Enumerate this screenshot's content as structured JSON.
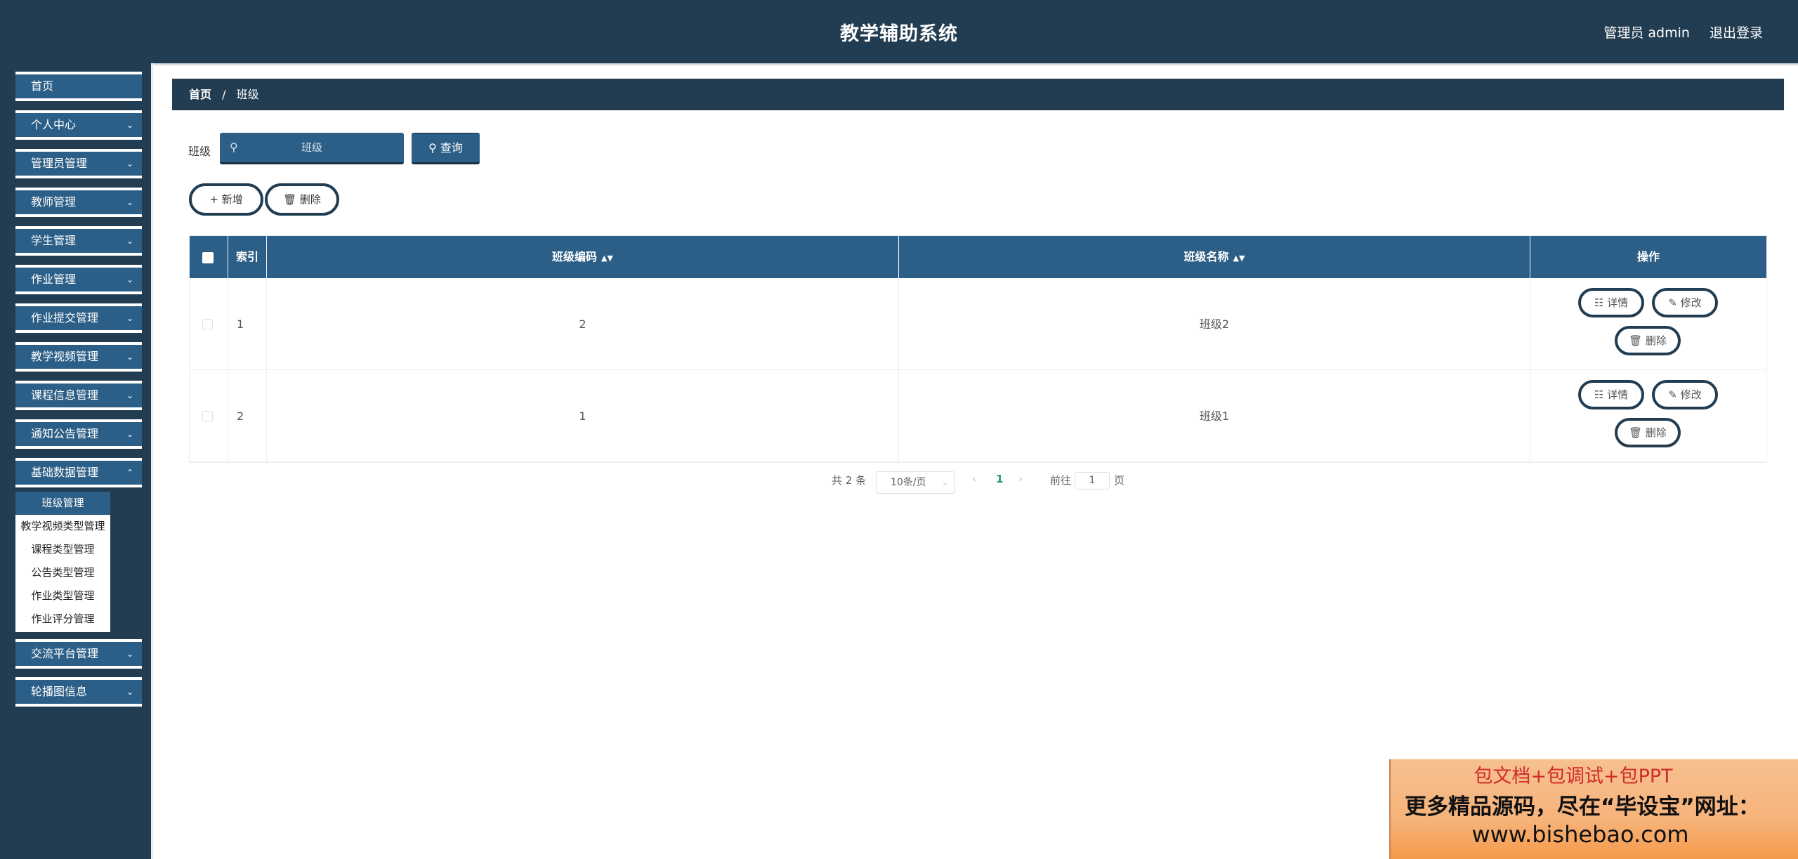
{
  "header": {
    "title": "教学辅助系统",
    "role_user": "管理员 admin",
    "logout_label": "退出登录"
  },
  "sidebar": {
    "items": [
      {
        "label": "首页",
        "expandable": false
      },
      {
        "label": "个人中心",
        "expandable": true
      },
      {
        "label": "管理员管理",
        "expandable": true
      },
      {
        "label": "教师管理",
        "expandable": true
      },
      {
        "label": "学生管理",
        "expandable": true
      },
      {
        "label": "作业管理",
        "expandable": true
      },
      {
        "label": "作业提交管理",
        "expandable": true
      },
      {
        "label": "教学视频管理",
        "expandable": true
      },
      {
        "label": "课程信息管理",
        "expandable": true
      },
      {
        "label": "通知公告管理",
        "expandable": true
      },
      {
        "label": "基础数据管理",
        "expandable": true
      }
    ],
    "submenu": [
      {
        "label": "班级管理",
        "active": true
      },
      {
        "label": "教学视频类型管理",
        "active": false
      },
      {
        "label": "课程类型管理",
        "active": false
      },
      {
        "label": "公告类型管理",
        "active": false
      },
      {
        "label": "作业类型管理",
        "active": false
      },
      {
        "label": "作业评分管理",
        "active": false
      }
    ],
    "items_after": [
      {
        "label": "交流平台管理",
        "expandable": true
      },
      {
        "label": "轮播图信息",
        "expandable": true
      }
    ]
  },
  "breadcrumb": {
    "home": "首页",
    "separator": "/",
    "current": "班级"
  },
  "search": {
    "label": "班级",
    "placeholder": "班级",
    "query_label": "查询"
  },
  "actions": {
    "add_label": "新增",
    "delete_label": "删除"
  },
  "table": {
    "columns": [
      "索引",
      "班级编码",
      "班级名称",
      "操作"
    ],
    "rows": [
      {
        "index": "1",
        "code": "2",
        "name": "班级2"
      },
      {
        "index": "2",
        "code": "1",
        "name": "班级1"
      }
    ],
    "row_actions": {
      "detail": "详情",
      "edit": "修改",
      "delete": "删除"
    }
  },
  "pagination": {
    "total_text": "共 2 条",
    "page_size": "10条/页",
    "current_page": "1",
    "goto_label": "前往",
    "goto_value": "1",
    "page_unit": "页"
  },
  "ad": {
    "line1": "包文档+包调试+包PPT",
    "line2": "更多精品源码，尽在“毕设宝”网址：",
    "line3": "www.bishebao.com"
  },
  "colors": {
    "header_bg": "#223d52",
    "accent": "#2c5f87",
    "active_page": "#19a15f"
  }
}
